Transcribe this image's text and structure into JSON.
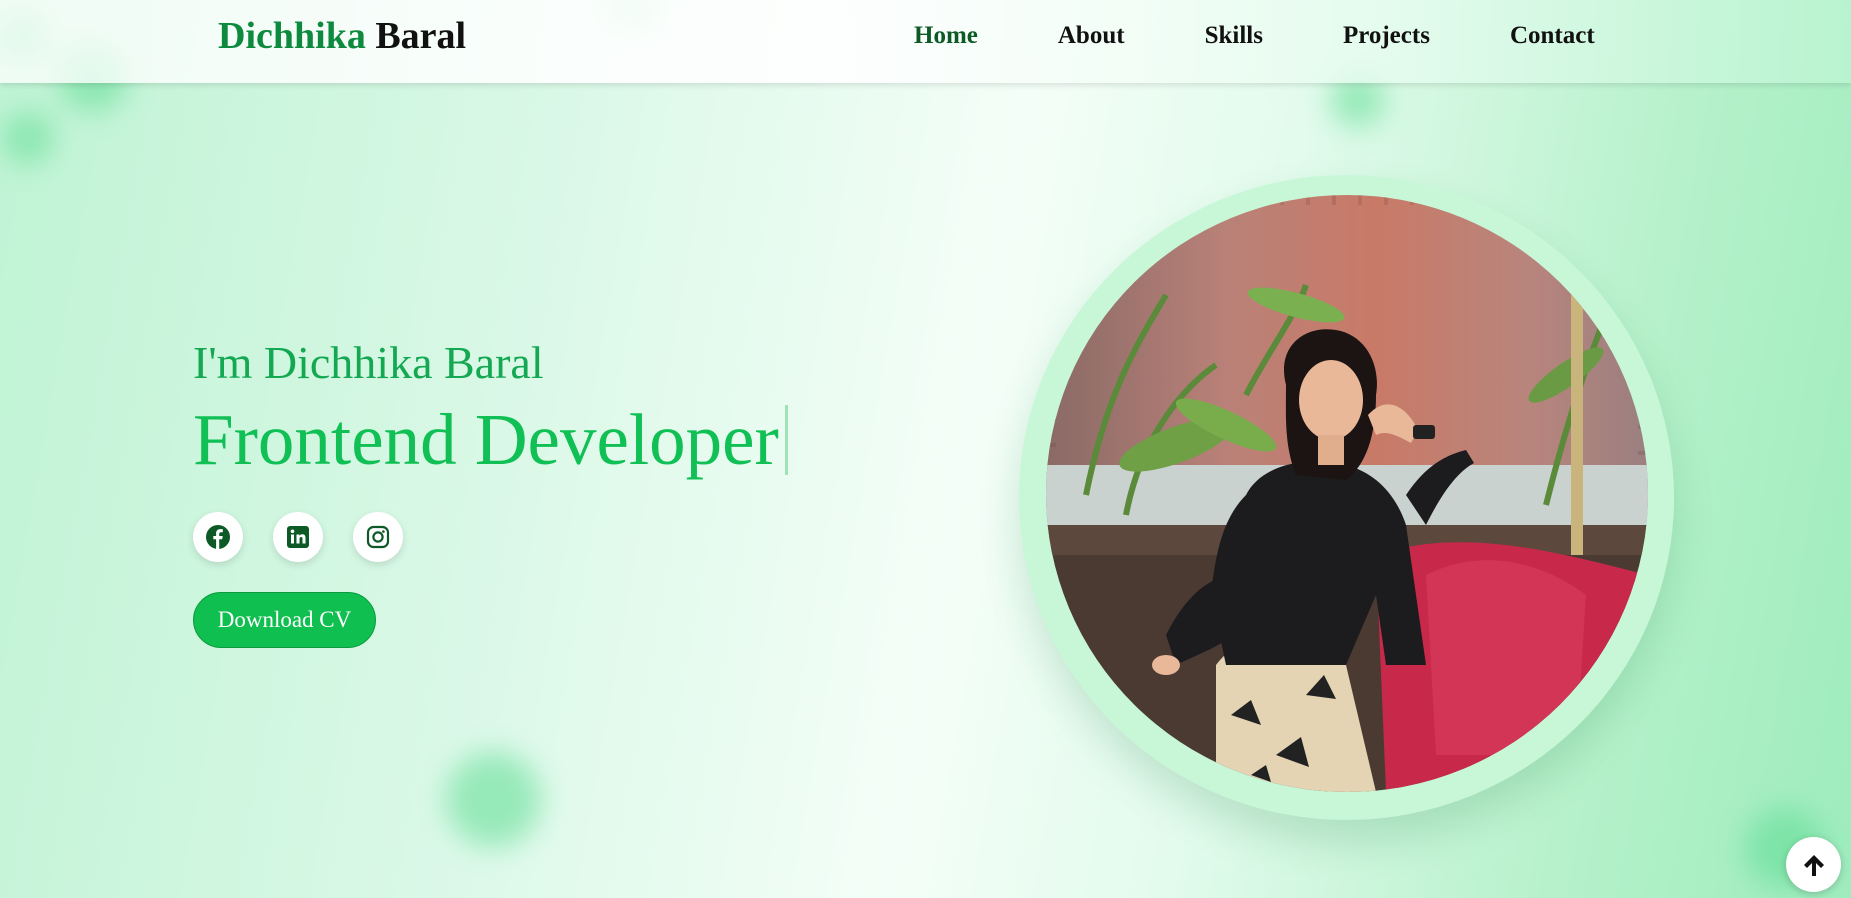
{
  "logo": {
    "first": "Dichhika",
    "last": "Baral"
  },
  "nav": {
    "home": "Home",
    "about": "About",
    "skills": "Skills",
    "projects": "Projects",
    "contact": "Contact"
  },
  "hero": {
    "greeting": "I'm Dichhika Baral",
    "role": "Frontend Developer",
    "cv_button": "Download CV"
  },
  "socials": [
    "facebook-icon",
    "linkedin-icon",
    "instagram-icon"
  ],
  "colors": {
    "accent": "#10c055",
    "brand_dark": "#0e8a3f",
    "nav_active": "#0e5a27",
    "button": "#0fbf4f"
  }
}
